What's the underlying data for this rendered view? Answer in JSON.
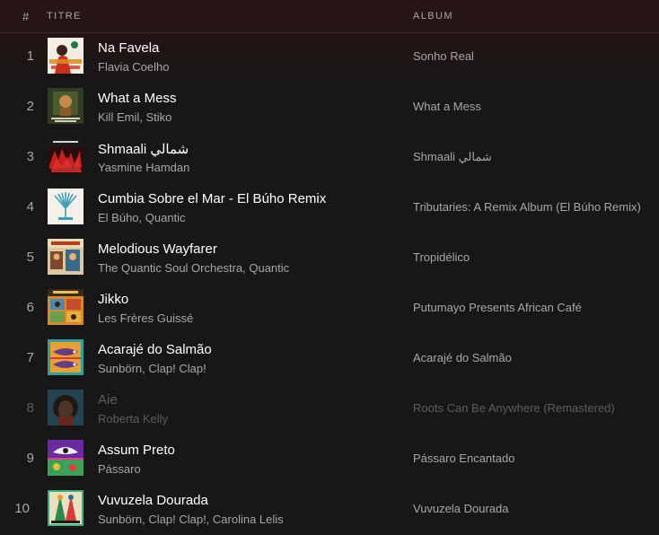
{
  "header": {
    "number_label": "#",
    "title_label": "TITRE",
    "album_label": "ALBUM"
  },
  "tracks": [
    {
      "number": "1",
      "title": "Na Favela",
      "artist": "Flavia Coelho",
      "album": "Sonho Real",
      "cover_icon": "album-cover-sonho-real",
      "available": true
    },
    {
      "number": "2",
      "title": "What a Mess",
      "artist": "Kill Emil, Stiko",
      "album": "What a Mess",
      "cover_icon": "album-cover-what-a-mess",
      "available": true
    },
    {
      "number": "3",
      "title": "Shmaali شمالي",
      "artist": "Yasmine Hamdan",
      "album": "Shmaali شمالي",
      "cover_icon": "album-cover-shmaali",
      "available": true
    },
    {
      "number": "4",
      "title": "Cumbia Sobre el Mar - El Búho Remix",
      "artist": "El Búho, Quantic",
      "album": "Tributaries: A Remix Album (El Búho Remix)",
      "cover_icon": "album-cover-tributaries",
      "available": true
    },
    {
      "number": "5",
      "title": "Melodious Wayfarer",
      "artist": "The Quantic Soul Orchestra, Quantic",
      "album": "Tropidélico",
      "cover_icon": "album-cover-tropidelico",
      "available": true
    },
    {
      "number": "6",
      "title": "Jikko",
      "artist": "Les Frères Guissé",
      "album": "Putumayo Presents African Café",
      "cover_icon": "album-cover-african-cafe",
      "available": true
    },
    {
      "number": "7",
      "title": "Acarajé do Salmão",
      "artist": "Sunbörn, Clap! Clap!",
      "album": "Acarajé do Salmão",
      "cover_icon": "album-cover-acaraje",
      "available": true
    },
    {
      "number": "8",
      "title": "Aie",
      "artist": "Roberta Kelly",
      "album": "Roots Can Be Anywhere (Remastered)",
      "cover_icon": "album-cover-roots",
      "available": false
    },
    {
      "number": "9",
      "title": "Assum Preto",
      "artist": "Pássaro",
      "album": "Pássaro Encantado",
      "cover_icon": "album-cover-passaro",
      "available": true
    },
    {
      "number": "10",
      "title": "Vuvuzela Dourada",
      "artist": "Sunbörn, Clap! Clap!, Carolina Lelis",
      "album": "Vuvuzela Dourada",
      "cover_icon": "album-cover-vuvuzela",
      "available": true
    }
  ],
  "colors": {
    "background": "#171717",
    "primary_text": "#ffffff",
    "secondary_text": "#a7a7a7",
    "disabled_text": "#5d5d5d"
  }
}
